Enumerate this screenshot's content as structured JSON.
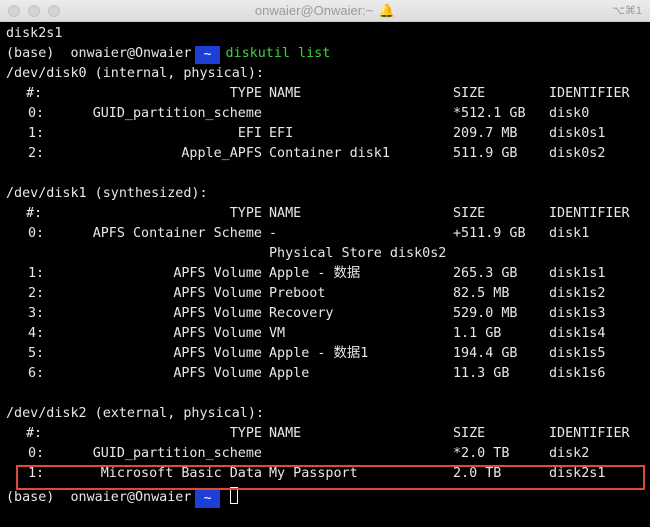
{
  "window": {
    "title": "onwaier@Onwaier:~",
    "shortcut": "⌥⌘1"
  },
  "prompt": {
    "env": "(base)",
    "user_host": "onwaier@Onwaier",
    "dir": "~"
  },
  "top_line": "disk2s1",
  "command": "diskutil list",
  "disks": [
    {
      "header": "/dev/disk0 (internal, physical):",
      "columns": {
        "num": "#:",
        "type": "TYPE",
        "name": "NAME",
        "size": "SIZE",
        "id": "IDENTIFIER"
      },
      "rows": [
        {
          "num": "0:",
          "type": "GUID_partition_scheme",
          "name": "",
          "size": "*512.1 GB",
          "id": "disk0"
        },
        {
          "num": "1:",
          "type": "EFI",
          "name": "EFI",
          "size": "209.7 MB",
          "id": "disk0s1"
        },
        {
          "num": "2:",
          "type": "Apple_APFS",
          "name": "Container disk1",
          "size": "511.9 GB",
          "id": "disk0s2"
        }
      ]
    },
    {
      "header": "/dev/disk1 (synthesized):",
      "columns": {
        "num": "#:",
        "type": "TYPE",
        "name": "NAME",
        "size": "SIZE",
        "id": "IDENTIFIER"
      },
      "rows": [
        {
          "num": "0:",
          "type": "APFS Container Scheme",
          "name": "-",
          "size": "+511.9 GB",
          "id": "disk1",
          "continuation": "Physical Store disk0s2"
        },
        {
          "num": "1:",
          "type": "APFS Volume",
          "name": "Apple - 数据",
          "size": "265.3 GB",
          "id": "disk1s1"
        },
        {
          "num": "2:",
          "type": "APFS Volume",
          "name": "Preboot",
          "size": "82.5 MB",
          "id": "disk1s2"
        },
        {
          "num": "3:",
          "type": "APFS Volume",
          "name": "Recovery",
          "size": "529.0 MB",
          "id": "disk1s3"
        },
        {
          "num": "4:",
          "type": "APFS Volume",
          "name": "VM",
          "size": "1.1 GB",
          "id": "disk1s4"
        },
        {
          "num": "5:",
          "type": "APFS Volume",
          "name": "Apple - 数据1",
          "size": "194.4 GB",
          "id": "disk1s5"
        },
        {
          "num": "6:",
          "type": "APFS Volume",
          "name": "Apple",
          "size": "11.3 GB",
          "id": "disk1s6"
        }
      ]
    },
    {
      "header": "/dev/disk2 (external, physical):",
      "columns": {
        "num": "#:",
        "type": "TYPE",
        "name": "NAME",
        "size": "SIZE",
        "id": "IDENTIFIER"
      },
      "rows": [
        {
          "num": "0:",
          "type": "GUID_partition_scheme",
          "name": "",
          "size": "*2.0 TB",
          "id": "disk2"
        },
        {
          "num": "1:",
          "type": "Microsoft Basic Data",
          "name": "My Passport",
          "size": "2.0 TB",
          "id": "disk2s1",
          "highlighted": true
        }
      ]
    }
  ],
  "colors": {
    "background": "#000000",
    "text": "#e8e8e8",
    "command": "#3fd13f",
    "prompt_badge": "#1d3fd6",
    "highlight_border": "#e0483a"
  }
}
